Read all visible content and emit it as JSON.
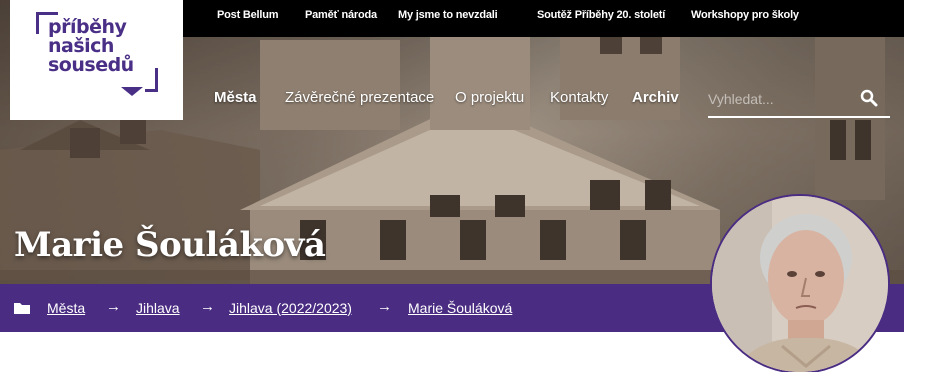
{
  "logo": {
    "lines": [
      "příběhy",
      "našich",
      "sousedů"
    ]
  },
  "topbar": {
    "links": [
      "Post Bellum",
      "Paměť národa",
      "My jsme to nevzdali",
      "Soutěž Příběhy 20. století",
      "Workshopy pro školy"
    ]
  },
  "mainnav": {
    "items": [
      "Města",
      "Závěrečné prezentace",
      "O projektu",
      "Kontakty",
      "Archiv"
    ],
    "active": "Města"
  },
  "search": {
    "placeholder": "Vyhledat...",
    "value": "",
    "icon": "search-icon"
  },
  "page": {
    "title": "Marie Šouláková"
  },
  "breadcrumb": {
    "icon": "folder-icon",
    "items": [
      "Města",
      "Jihlava",
      "Jihlava (2022/2023)",
      "Marie Šouláková"
    ],
    "separator": "→"
  },
  "colors": {
    "brand_purple": "#4a2c82",
    "topbar": "#000000",
    "text_on_dark": "#ffffff"
  }
}
